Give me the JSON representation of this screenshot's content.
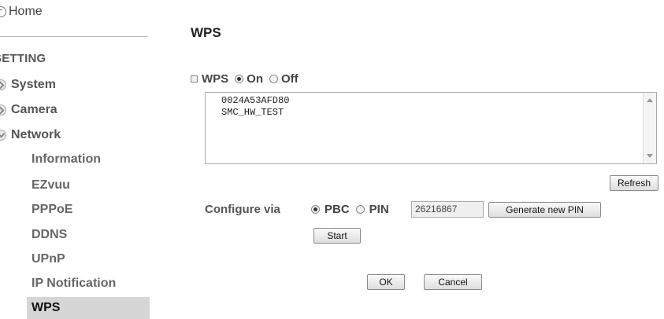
{
  "sidebar": {
    "home_label": "Home",
    "section_label": "SETTING",
    "groups": [
      {
        "label": "System"
      },
      {
        "label": "Camera"
      },
      {
        "label": "Network"
      }
    ],
    "network_items": [
      {
        "label": "Information"
      },
      {
        "label": "EZvuu"
      },
      {
        "label": "PPPoE"
      },
      {
        "label": "DDNS"
      },
      {
        "label": "UPnP"
      },
      {
        "label": "IP Notification"
      },
      {
        "label": "WPS"
      }
    ],
    "active_item": "WPS"
  },
  "main": {
    "title": "WPS",
    "wps_label": "WPS",
    "on_label": "On",
    "off_label": "Off",
    "wps_selected": "On",
    "ap_list": [
      "0024A53AFD80",
      "SMC_HW_TEST"
    ],
    "refresh_label": "Refresh",
    "configure_label": "Configure via",
    "pbc_label": "PBC",
    "pin_label": "PIN",
    "config_selected": "PBC",
    "pin_value": "26216867",
    "generate_pin_label": "Generate new PIN",
    "start_label": "Start",
    "ok_label": "OK",
    "cancel_label": "Cancel"
  }
}
